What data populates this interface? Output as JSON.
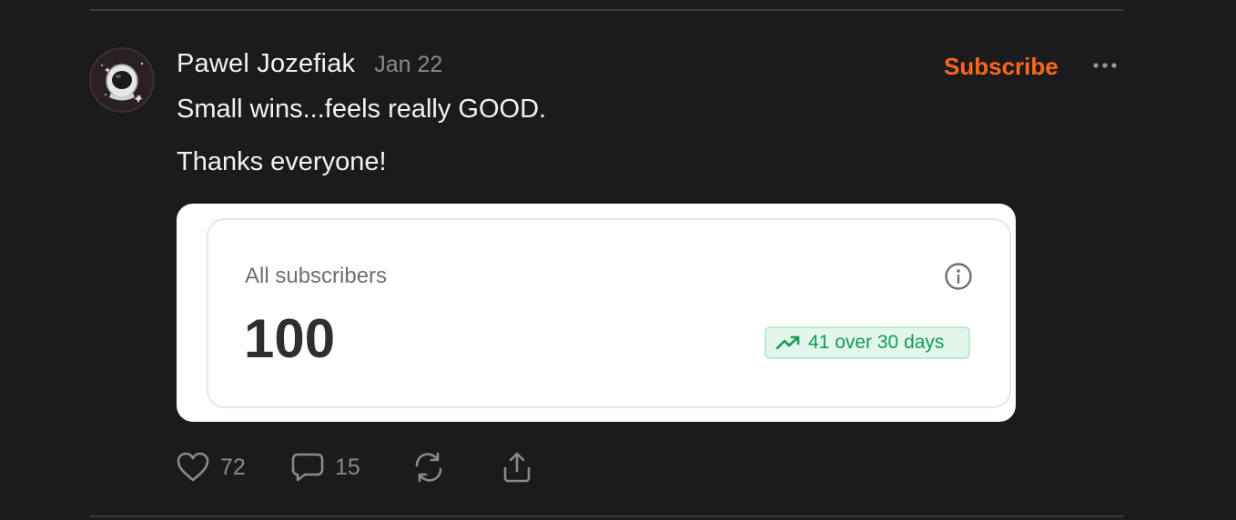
{
  "post": {
    "author": "Pawel Jozefiak",
    "date": "Jan 22",
    "subscribe_label": "Subscribe",
    "body": [
      "Small wins...feels really GOOD.",
      "Thanks everyone!"
    ]
  },
  "card": {
    "label": "All subscribers",
    "value": "100",
    "growth": "41 over 30 days"
  },
  "actions": {
    "likes": "72",
    "comments": "15"
  },
  "icons": {
    "avatar": "astronaut-avatar",
    "more": "more-dots-icon",
    "info": "info-icon",
    "trend": "trend-up-icon",
    "like": "heart-icon",
    "comment": "comment-bubble-icon",
    "restack": "restack-icon",
    "share": "share-icon"
  },
  "colors": {
    "background": "#1b1b1d",
    "accent": "#ff6719",
    "growth_text": "#149a52",
    "growth_bg": "#e2f6ec"
  }
}
